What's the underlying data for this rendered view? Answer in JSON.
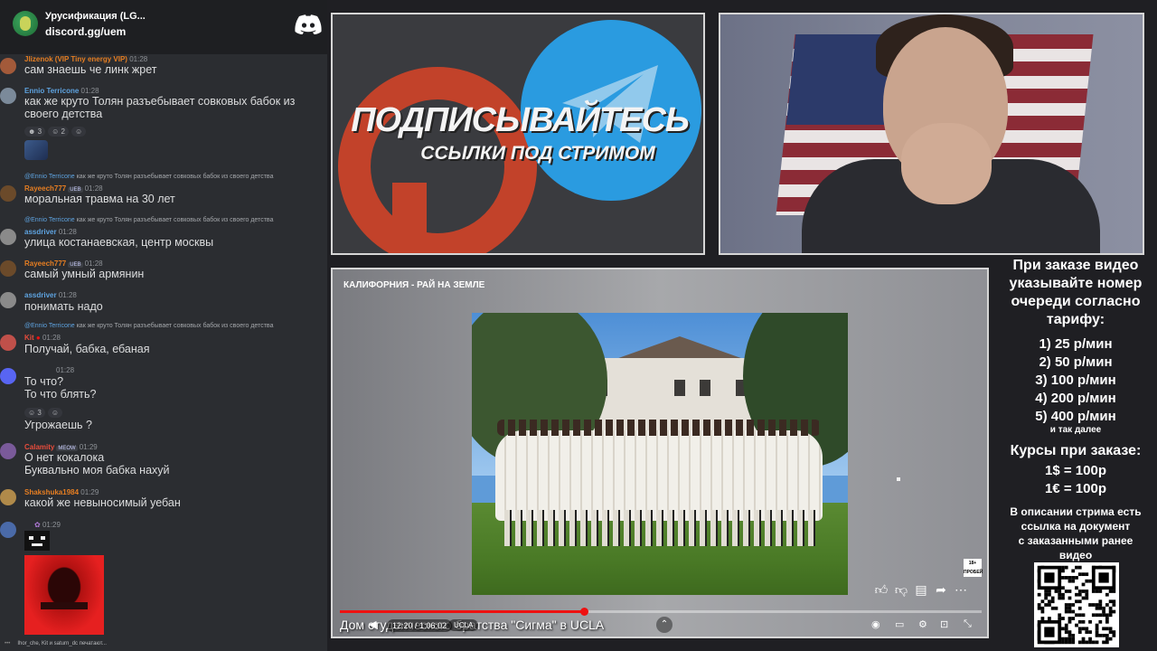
{
  "server": {
    "name": "Урусификация (LG...",
    "invite": "discord.gg/uem"
  },
  "chat": {
    "m1": {
      "user": "Jlizenok (VIP Tiny energy VIP)",
      "time": "01:28",
      "text": "сам знаешь че линк жрет"
    },
    "m2": {
      "user": "Ennio Terricone",
      "time": "01:28",
      "text1": "как же круто Толян разъебывает совковых бабок из",
      "text2": "своего детства",
      "r1": "3",
      "r2": "2"
    },
    "m3": {
      "reply_user": "@Ennio Terricone",
      "reply_text": "как же круто Толян разъебывает совковых бабок из своего детства",
      "user": "Rayeech777",
      "tag": "UEB",
      "time": "01:28",
      "text": "моральная травма на 30 лет"
    },
    "m4": {
      "reply_user": "@Ennio Terricone",
      "reply_text": "как же круто Толян разъебывает совковых бабок из своего детства",
      "user": "assdriver",
      "time": "01:28",
      "text": "улица костанаевская, центр москвы"
    },
    "m5": {
      "user": "Rayeech777",
      "tag": "UEB",
      "time": "01:28",
      "text": "самый умный армянин"
    },
    "m6": {
      "user": "assdriver",
      "time": "01:28",
      "text": "понимать надо"
    },
    "m7": {
      "reply_user": "@Ennio Terricone",
      "reply_text": "как же круто Толян разъебывает совковых бабок из своего детства",
      "user": "Kit",
      "time": "01:28",
      "text": "Получай, бабка, ебаная"
    },
    "m8": {
      "time": "01:28",
      "text1": "То что?",
      "text2": "То что блять?",
      "r1": "3",
      "text3": "Угрожаешь ?"
    },
    "m9": {
      "user": "Calamity",
      "tag": "MEOW",
      "time": "01:29",
      "text1": "О нет кокалока",
      "text2": "Буквально моя бабка нахуй"
    },
    "m10": {
      "user": "Shakshuka1984",
      "time": "01:29",
      "text": "какой же невыносимый уебан"
    },
    "m11": {
      "time": "01:29"
    },
    "typing": "Ihor_che, Kit и saturn_dc печатают..."
  },
  "banner": {
    "title": "ПОДПИСЫВАЙТЕСЬ",
    "subtitle": "ССЫЛКИ ПОД СТРИМОМ"
  },
  "video": {
    "label": "КАЛИФОРНИЯ - РАЙ НА ЗЕМЛЕ",
    "title": "Дом студенческого братства \"Сигма\" в UCLA",
    "time": "12:20 / 1:06:02",
    "chapter": "UCLA",
    "progress_percent": 38,
    "rating": "18+ ПРОБЕЙ"
  },
  "info": {
    "heading": [
      "При заказе видео",
      "указывайте номер",
      "очереди согласно",
      "тарифу:"
    ],
    "tariffs": [
      "1) 25 р/мин",
      "2) 50 р/мин",
      "3) 100 р/мин",
      "4) 200 р/мин",
      "5) 400 р/мин"
    ],
    "more": "и так далее",
    "rates_title": "Курсы при заказе:",
    "rates": [
      "1$ = 100р",
      "1€ = 100р"
    ],
    "desc": [
      "В описании стрима есть",
      "ссылка на документ",
      "с заказанными ранее",
      "видео"
    ]
  },
  "colors": {
    "discord_bg": "#2b2d31",
    "accent_red": "#e11",
    "telegram_blue": "#2a9be0"
  }
}
